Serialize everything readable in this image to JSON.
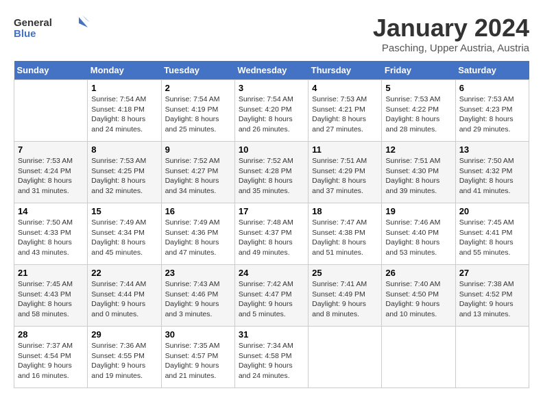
{
  "header": {
    "logo_general": "General",
    "logo_blue": "Blue",
    "month_title": "January 2024",
    "location": "Pasching, Upper Austria, Austria"
  },
  "days_of_week": [
    "Sunday",
    "Monday",
    "Tuesday",
    "Wednesday",
    "Thursday",
    "Friday",
    "Saturday"
  ],
  "weeks": [
    [
      {
        "day": "",
        "sunrise": "",
        "sunset": "",
        "daylight": ""
      },
      {
        "day": "1",
        "sunrise": "Sunrise: 7:54 AM",
        "sunset": "Sunset: 4:18 PM",
        "daylight": "Daylight: 8 hours and 24 minutes."
      },
      {
        "day": "2",
        "sunrise": "Sunrise: 7:54 AM",
        "sunset": "Sunset: 4:19 PM",
        "daylight": "Daylight: 8 hours and 25 minutes."
      },
      {
        "day": "3",
        "sunrise": "Sunrise: 7:54 AM",
        "sunset": "Sunset: 4:20 PM",
        "daylight": "Daylight: 8 hours and 26 minutes."
      },
      {
        "day": "4",
        "sunrise": "Sunrise: 7:53 AM",
        "sunset": "Sunset: 4:21 PM",
        "daylight": "Daylight: 8 hours and 27 minutes."
      },
      {
        "day": "5",
        "sunrise": "Sunrise: 7:53 AM",
        "sunset": "Sunset: 4:22 PM",
        "daylight": "Daylight: 8 hours and 28 minutes."
      },
      {
        "day": "6",
        "sunrise": "Sunrise: 7:53 AM",
        "sunset": "Sunset: 4:23 PM",
        "daylight": "Daylight: 8 hours and 29 minutes."
      }
    ],
    [
      {
        "day": "7",
        "sunrise": "Sunrise: 7:53 AM",
        "sunset": "Sunset: 4:24 PM",
        "daylight": "Daylight: 8 hours and 31 minutes."
      },
      {
        "day": "8",
        "sunrise": "Sunrise: 7:53 AM",
        "sunset": "Sunset: 4:25 PM",
        "daylight": "Daylight: 8 hours and 32 minutes."
      },
      {
        "day": "9",
        "sunrise": "Sunrise: 7:52 AM",
        "sunset": "Sunset: 4:27 PM",
        "daylight": "Daylight: 8 hours and 34 minutes."
      },
      {
        "day": "10",
        "sunrise": "Sunrise: 7:52 AM",
        "sunset": "Sunset: 4:28 PM",
        "daylight": "Daylight: 8 hours and 35 minutes."
      },
      {
        "day": "11",
        "sunrise": "Sunrise: 7:51 AM",
        "sunset": "Sunset: 4:29 PM",
        "daylight": "Daylight: 8 hours and 37 minutes."
      },
      {
        "day": "12",
        "sunrise": "Sunrise: 7:51 AM",
        "sunset": "Sunset: 4:30 PM",
        "daylight": "Daylight: 8 hours and 39 minutes."
      },
      {
        "day": "13",
        "sunrise": "Sunrise: 7:50 AM",
        "sunset": "Sunset: 4:32 PM",
        "daylight": "Daylight: 8 hours and 41 minutes."
      }
    ],
    [
      {
        "day": "14",
        "sunrise": "Sunrise: 7:50 AM",
        "sunset": "Sunset: 4:33 PM",
        "daylight": "Daylight: 8 hours and 43 minutes."
      },
      {
        "day": "15",
        "sunrise": "Sunrise: 7:49 AM",
        "sunset": "Sunset: 4:34 PM",
        "daylight": "Daylight: 8 hours and 45 minutes."
      },
      {
        "day": "16",
        "sunrise": "Sunrise: 7:49 AM",
        "sunset": "Sunset: 4:36 PM",
        "daylight": "Daylight: 8 hours and 47 minutes."
      },
      {
        "day": "17",
        "sunrise": "Sunrise: 7:48 AM",
        "sunset": "Sunset: 4:37 PM",
        "daylight": "Daylight: 8 hours and 49 minutes."
      },
      {
        "day": "18",
        "sunrise": "Sunrise: 7:47 AM",
        "sunset": "Sunset: 4:38 PM",
        "daylight": "Daylight: 8 hours and 51 minutes."
      },
      {
        "day": "19",
        "sunrise": "Sunrise: 7:46 AM",
        "sunset": "Sunset: 4:40 PM",
        "daylight": "Daylight: 8 hours and 53 minutes."
      },
      {
        "day": "20",
        "sunrise": "Sunrise: 7:45 AM",
        "sunset": "Sunset: 4:41 PM",
        "daylight": "Daylight: 8 hours and 55 minutes."
      }
    ],
    [
      {
        "day": "21",
        "sunrise": "Sunrise: 7:45 AM",
        "sunset": "Sunset: 4:43 PM",
        "daylight": "Daylight: 8 hours and 58 minutes."
      },
      {
        "day": "22",
        "sunrise": "Sunrise: 7:44 AM",
        "sunset": "Sunset: 4:44 PM",
        "daylight": "Daylight: 9 hours and 0 minutes."
      },
      {
        "day": "23",
        "sunrise": "Sunrise: 7:43 AM",
        "sunset": "Sunset: 4:46 PM",
        "daylight": "Daylight: 9 hours and 3 minutes."
      },
      {
        "day": "24",
        "sunrise": "Sunrise: 7:42 AM",
        "sunset": "Sunset: 4:47 PM",
        "daylight": "Daylight: 9 hours and 5 minutes."
      },
      {
        "day": "25",
        "sunrise": "Sunrise: 7:41 AM",
        "sunset": "Sunset: 4:49 PM",
        "daylight": "Daylight: 9 hours and 8 minutes."
      },
      {
        "day": "26",
        "sunrise": "Sunrise: 7:40 AM",
        "sunset": "Sunset: 4:50 PM",
        "daylight": "Daylight: 9 hours and 10 minutes."
      },
      {
        "day": "27",
        "sunrise": "Sunrise: 7:38 AM",
        "sunset": "Sunset: 4:52 PM",
        "daylight": "Daylight: 9 hours and 13 minutes."
      }
    ],
    [
      {
        "day": "28",
        "sunrise": "Sunrise: 7:37 AM",
        "sunset": "Sunset: 4:54 PM",
        "daylight": "Daylight: 9 hours and 16 minutes."
      },
      {
        "day": "29",
        "sunrise": "Sunrise: 7:36 AM",
        "sunset": "Sunset: 4:55 PM",
        "daylight": "Daylight: 9 hours and 19 minutes."
      },
      {
        "day": "30",
        "sunrise": "Sunrise: 7:35 AM",
        "sunset": "Sunset: 4:57 PM",
        "daylight": "Daylight: 9 hours and 21 minutes."
      },
      {
        "day": "31",
        "sunrise": "Sunrise: 7:34 AM",
        "sunset": "Sunset: 4:58 PM",
        "daylight": "Daylight: 9 hours and 24 minutes."
      },
      {
        "day": "",
        "sunrise": "",
        "sunset": "",
        "daylight": ""
      },
      {
        "day": "",
        "sunrise": "",
        "sunset": "",
        "daylight": ""
      },
      {
        "day": "",
        "sunrise": "",
        "sunset": "",
        "daylight": ""
      }
    ]
  ]
}
